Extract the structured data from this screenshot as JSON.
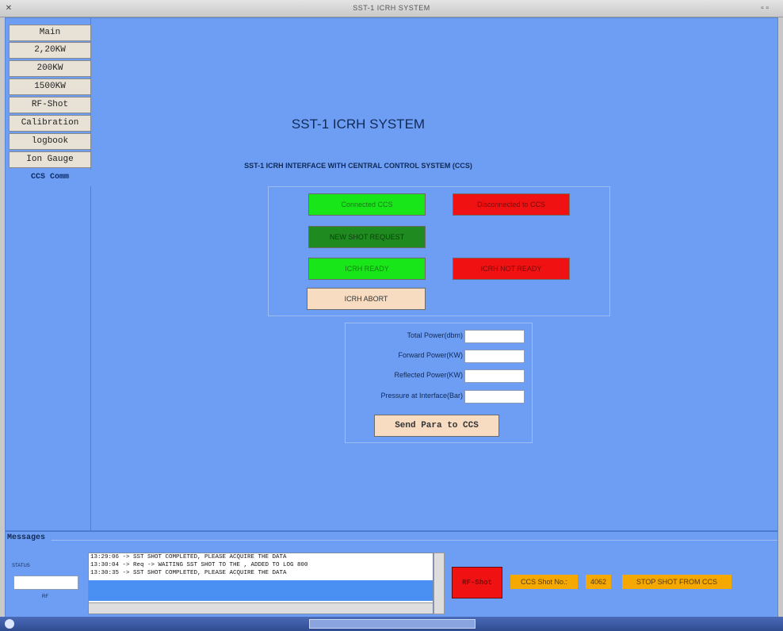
{
  "window": {
    "title": "SST-1 ICRH SYSTEM",
    "close_glyph": "✕",
    "window_buttons_glyph": "▫ ▫"
  },
  "sidebar": {
    "items": [
      {
        "label": "Main"
      },
      {
        "label": "2,20KW"
      },
      {
        "label": "200KW"
      },
      {
        "label": "1500KW"
      },
      {
        "label": "RF-Shot"
      },
      {
        "label": "Calibration"
      },
      {
        "label": "logbook"
      },
      {
        "label": "Ion Gauge"
      },
      {
        "label": "CCS Comm"
      }
    ]
  },
  "main": {
    "title": "SST-1 ICRH SYSTEM",
    "subtitle": "SST-1 ICRH INTERFACE WITH CENTRAL CONTROL SYSTEM (CCS)",
    "buttons": {
      "connected": "Connected CCS",
      "disconnected": "Disconnected to CCS",
      "new_shot": "NEW SHOT REQUEST",
      "icrh_ready": "ICRH READY",
      "icrh_not_ready": "ICRH NOT READY",
      "icrh_abort": "ICRH ABORT"
    },
    "params": {
      "total_power_label": "Total Power(dbm)",
      "forward_power_label": "Forward Power(KW)",
      "reflected_power_label": "Reflected Power(KW)",
      "pressure_label": "Pressure at Interface(Bar)",
      "send_label": "Send Para to CCS"
    }
  },
  "messages": {
    "title": "Messages",
    "status_label": "STATUS",
    "small_label": "RF",
    "log": [
      "13:29:06 -> SST SHOT COMPLETED, PLEASE ACQUIRE THE DATA",
      "13:30:04 -> Req -> WAITING SST SHOT TO THE , ADDED TO LOG 800",
      "13:30:35 -> SST SHOT COMPLETED, PLEASE ACQUIRE THE DATA"
    ],
    "rf_shot": "RF-Shot",
    "ccs_shot_label": "CCS Shot No.:",
    "ccs_shot_value": "4062",
    "stop_shot": "STOP SHOT FROM CCS"
  },
  "colors": {
    "background": "#6e9ef4",
    "green": "#19e619",
    "red": "#f01212",
    "orange": "#f5a800"
  }
}
